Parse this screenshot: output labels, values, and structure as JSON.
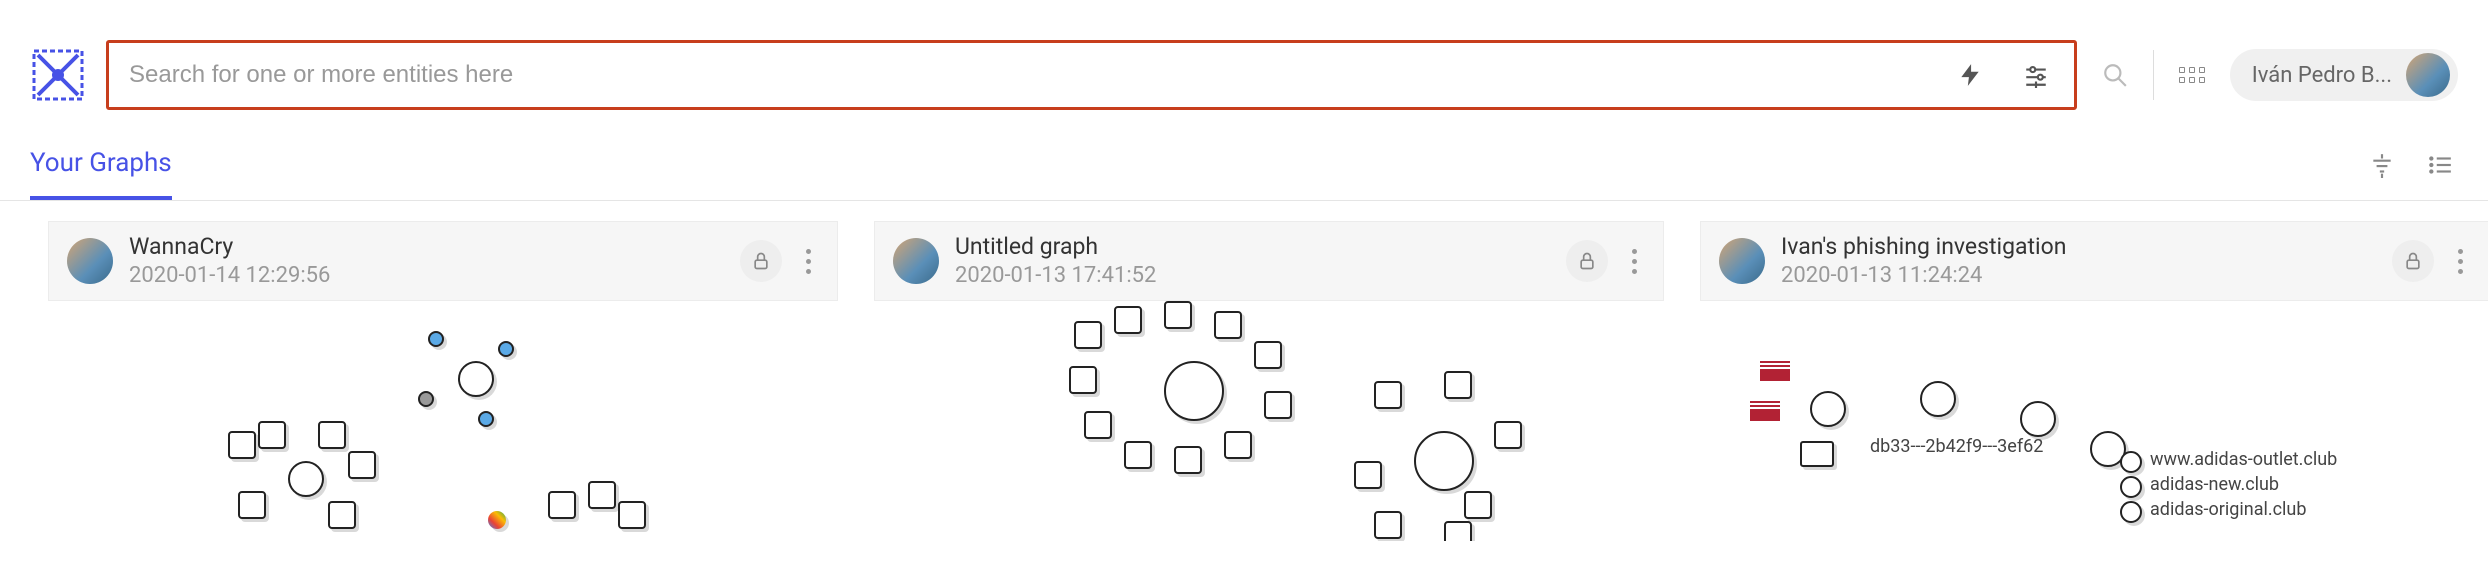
{
  "search": {
    "placeholder": "Search for one or more entities here"
  },
  "user": {
    "display_name": "Iván Pedro B..."
  },
  "tabs": {
    "active_label": "Your Graphs"
  },
  "cards": [
    {
      "title": "WannaCry",
      "timestamp": "2020-01-14 12:29:56"
    },
    {
      "title": "Untitled graph",
      "timestamp": "2020-01-13 17:41:52"
    },
    {
      "title": "Ivan's phishing investigation",
      "timestamp": "2020-01-13 11:24:24"
    }
  ],
  "graph3_labels": {
    "hash": "db33---2b42f9---3ef62",
    "domain1": "www.adidas-outlet.club",
    "domain2": "adidas-new.club",
    "domain3": "adidas-original.club"
  }
}
